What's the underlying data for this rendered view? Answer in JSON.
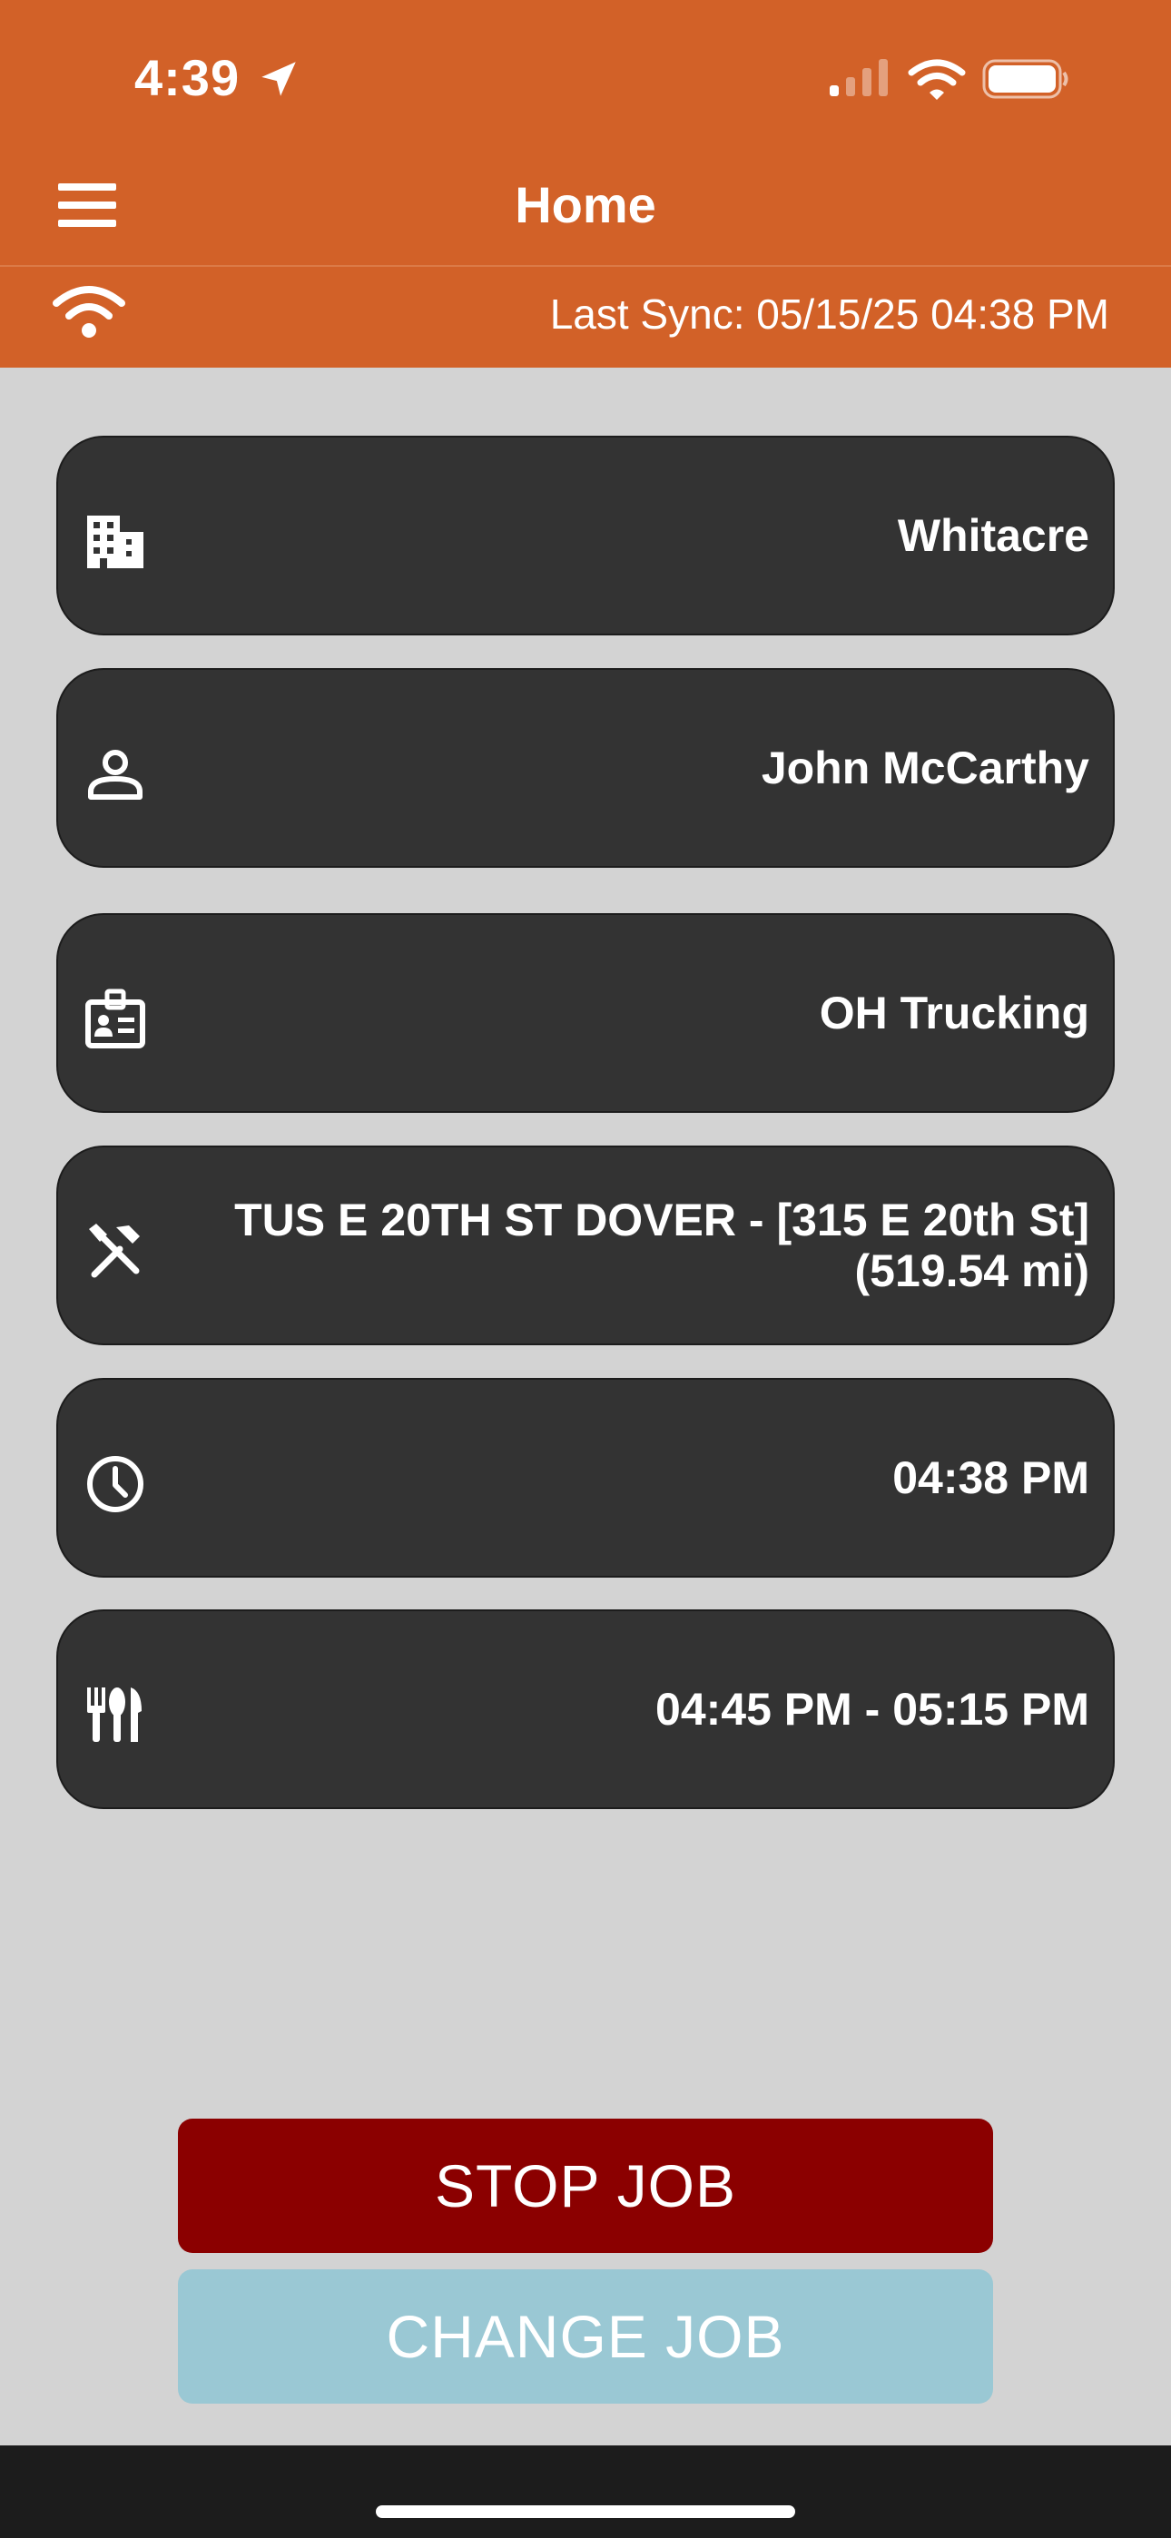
{
  "status_bar": {
    "time": "4:39",
    "icons": [
      "location-arrow-icon",
      "cellular-signal-icon",
      "wifi-icon",
      "battery-icon"
    ]
  },
  "header": {
    "title": "Home",
    "menu_icon": "hamburger-menu-icon"
  },
  "sync_bar": {
    "icon": "wifi-icon",
    "last_sync": "Last Sync: 05/15/25 04:38 PM"
  },
  "cards": [
    {
      "icon": "building-icon",
      "text": "Whitacre"
    },
    {
      "icon": "person-icon",
      "text": "John McCarthy"
    },
    {
      "icon": "badge-icon",
      "text": "OH Trucking"
    },
    {
      "icon": "tools-icon",
      "text": "TUS E 20TH ST DOVER - [315 E 20th St] (519.54 mi)"
    },
    {
      "icon": "clock-icon",
      "text": "04:38 PM"
    },
    {
      "icon": "utensils-icon",
      "text": "04:45 PM - 05:15 PM"
    }
  ],
  "buttons": {
    "stop_job": "STOP JOB",
    "change_job": "CHANGE JOB"
  },
  "colors": {
    "header": "#d26128",
    "background": "#d3d3d3",
    "card": "#333333",
    "stop_button": "#8b0000",
    "change_button": "#9ac8d4",
    "home_bar": "#1c1c1c"
  }
}
